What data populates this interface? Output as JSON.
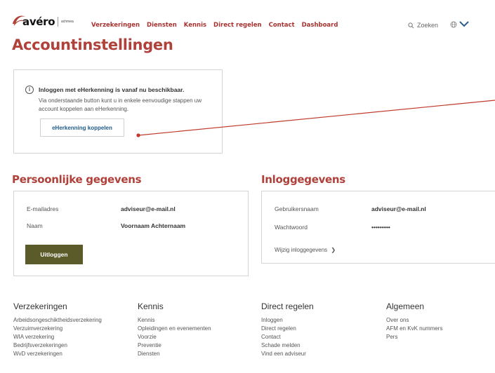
{
  "header": {
    "logo_text": "avéro",
    "logo_sub": "achmea",
    "nav": [
      "Verzekeringen",
      "Diensten",
      "Kennis",
      "Direct regelen",
      "Contact",
      "Dashboard"
    ],
    "search_label": "Zoeken"
  },
  "page": {
    "title": "Accountinstellingen"
  },
  "notice": {
    "icon": "info-icon",
    "title": "Inloggen met eHerkenning is vanaf nu beschikbaar.",
    "body": "Via onderstaande button kunt u in enkele eenvoudige stappen uw account koppelen aan eHerkenning.",
    "button": "eHerkenning koppelen"
  },
  "personal": {
    "heading": "Persoonlijke gegevens",
    "email_label": "E-mailadres",
    "email_value": "adviseur@e-mail.nl",
    "name_label": "Naam",
    "name_value": "Voornaam Achternaam",
    "logout": "Uitloggen"
  },
  "login": {
    "heading": "Inloggegevens",
    "user_label": "Gebruikersnaam",
    "user_value": "adviseur@e-mail.nl",
    "pass_label": "Wachtwoord",
    "pass_value": "•••••••••",
    "edit_link": "Wijzig inloggegevens"
  },
  "footer": {
    "columns": [
      {
        "heading": "Verzekeringen",
        "links": [
          "Arbeidsongeschiktheidsverzekering",
          "Verzuimverzekering",
          "WIA verzekering",
          "Bedrijfsverzekeringen",
          "WvD verzekeringen"
        ]
      },
      {
        "heading": "Kennis",
        "links": [
          "Kennis",
          "Opleidingen en evenementen",
          "Voorzie",
          "Preventie",
          "Diensten"
        ]
      },
      {
        "heading": "Direct regelen",
        "links": [
          "Inloggen",
          "Direct regelen",
          "Contact",
          "Schade melden",
          "Vind een adviseur"
        ]
      },
      {
        "heading": "Algemeen",
        "links": [
          "Over ons",
          "AFM en KvK nummers",
          "Pers"
        ]
      }
    ]
  },
  "colors": {
    "brand": "#b0413a",
    "nav": "#a6332f",
    "button": "#5b5a29",
    "link": "#1f5c8a"
  }
}
